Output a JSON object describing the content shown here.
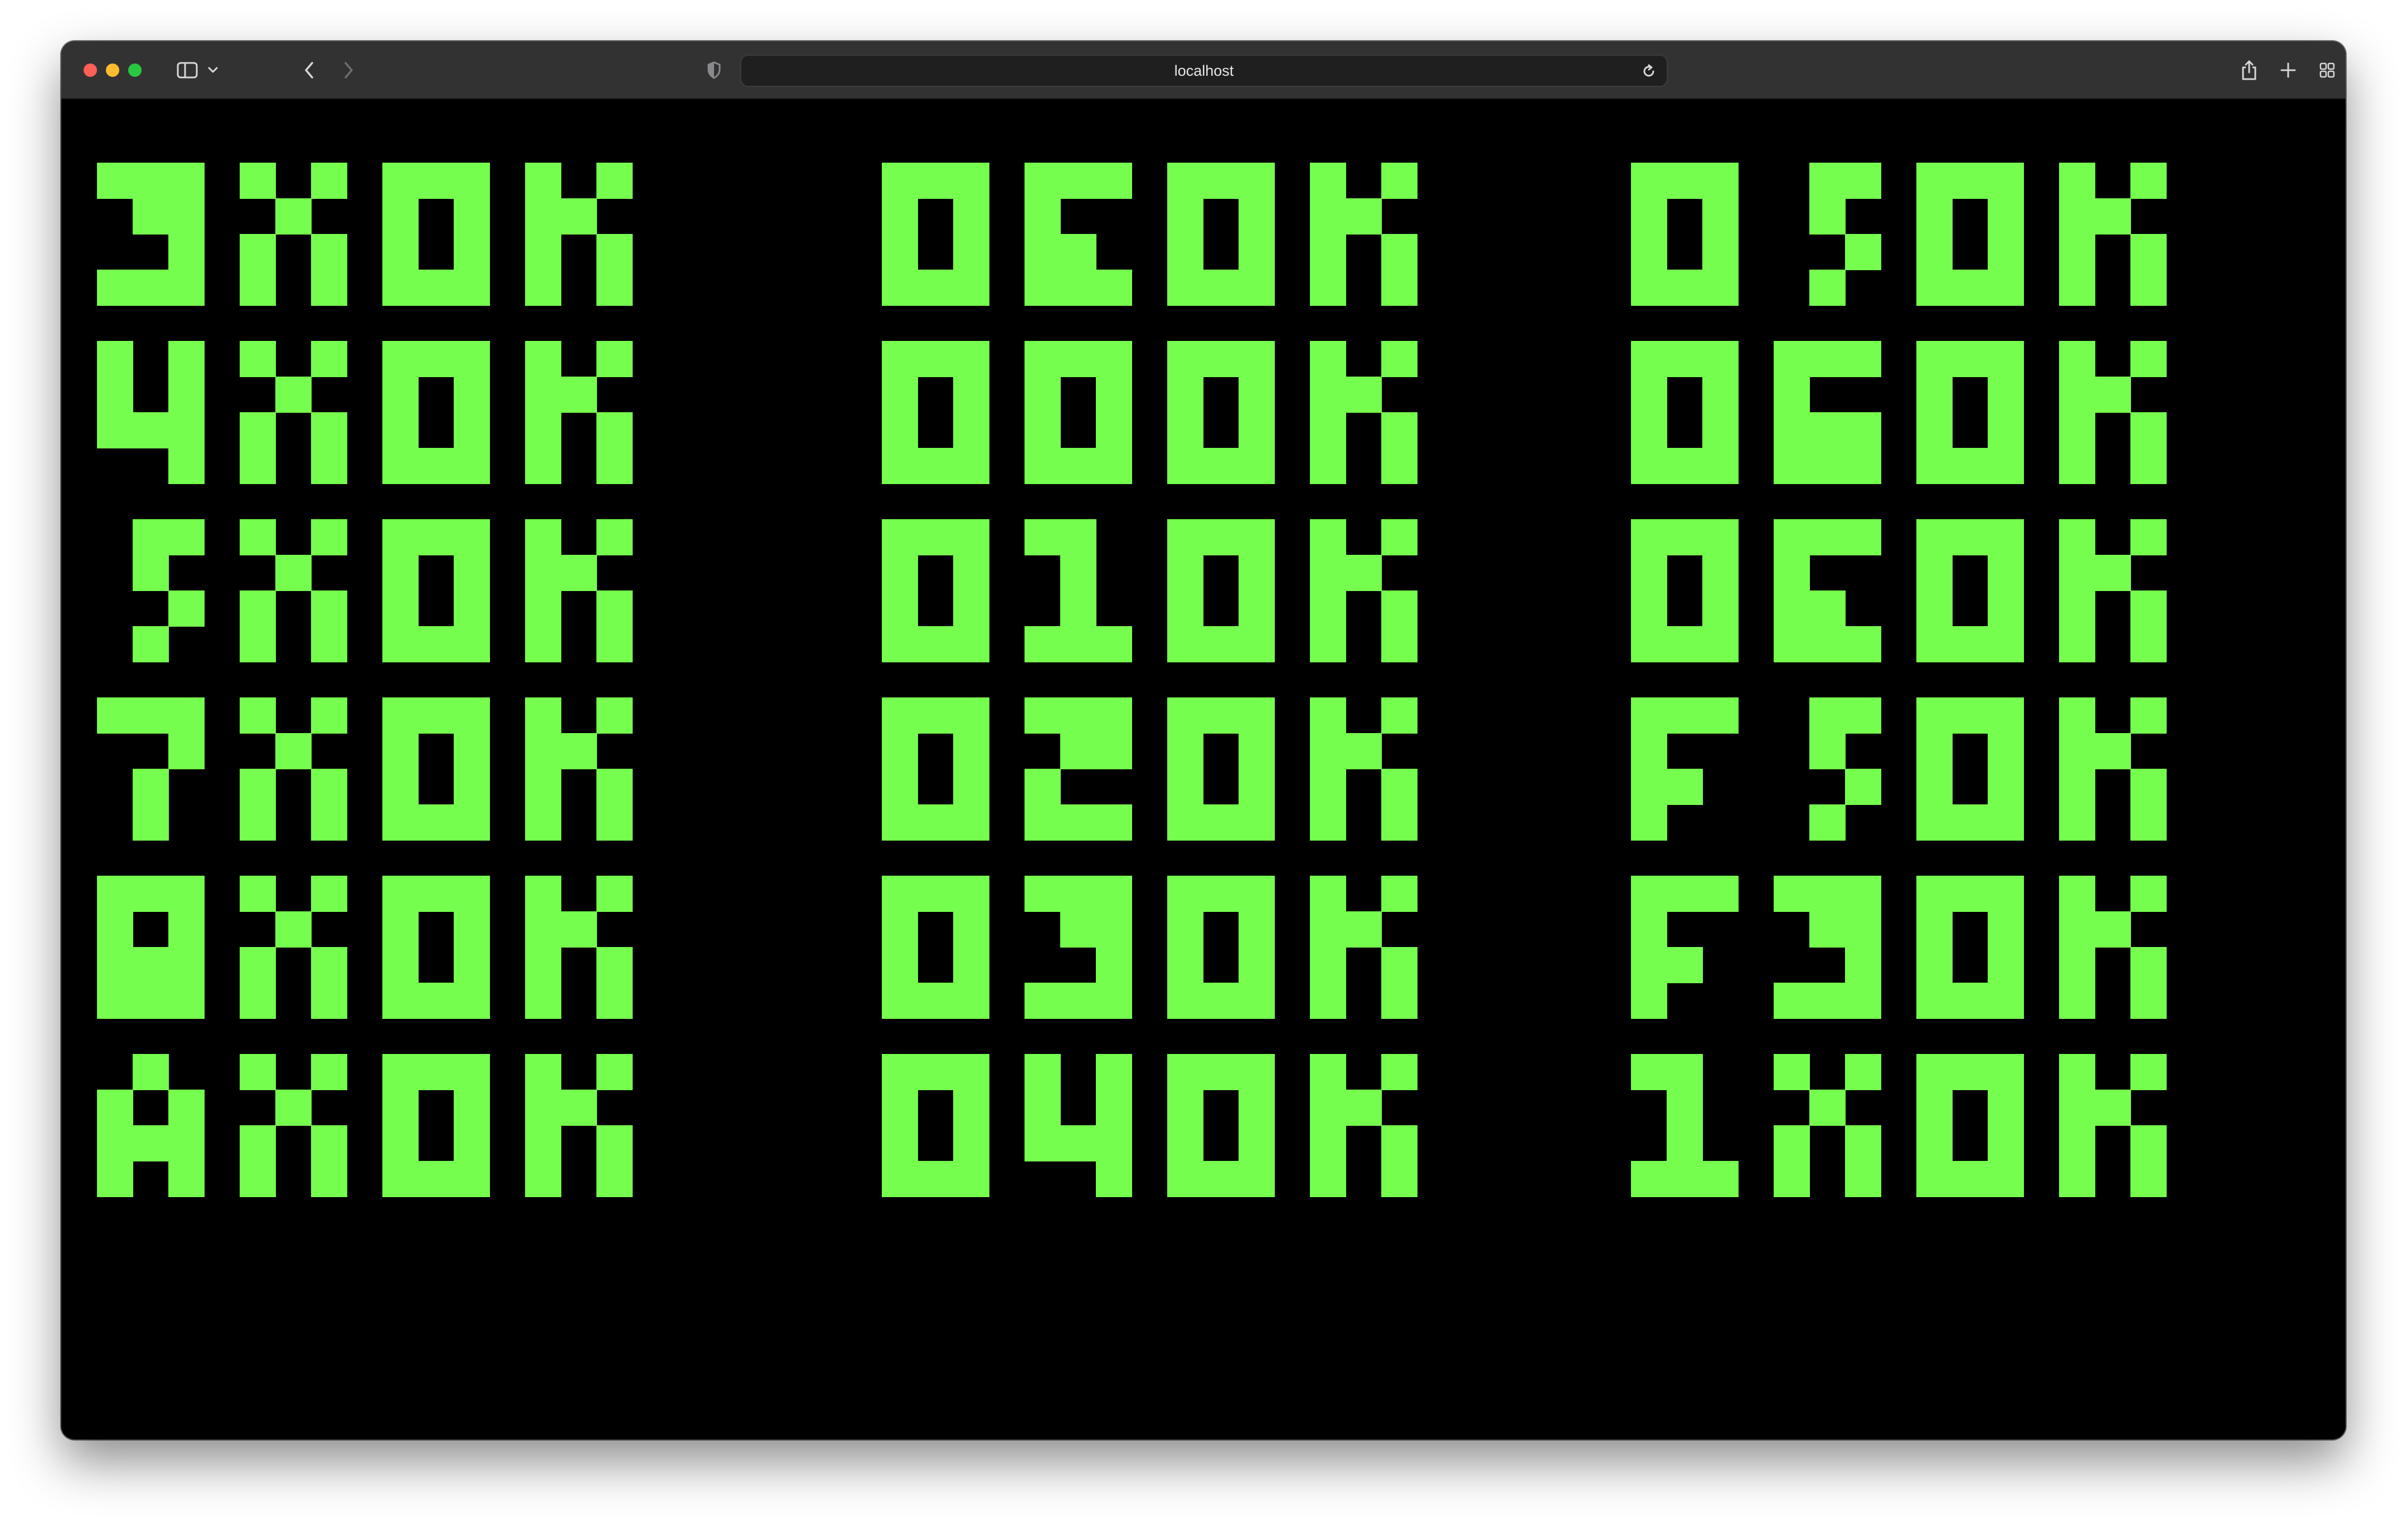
{
  "browser": {
    "address": "localhost",
    "traffic_lights": {
      "close": "#fe5f57",
      "minimize": "#febc2e",
      "maximize": "#28c840"
    },
    "icons": {
      "sidebar": "sidebar-icon",
      "sidebar_menu": "chevron-down-icon",
      "back": "chevron-left-icon",
      "forward": "chevron-right-icon",
      "privacy": "shield-icon",
      "reload": "reload-icon",
      "share": "share-icon",
      "new_tab": "plus-icon",
      "tab_overview": "tab-overview-icon"
    }
  },
  "display": {
    "foreground": "#76fe4e",
    "background": "#000000",
    "columns": [
      {
        "rows": [
          [
            "3",
            "X",
            "O",
            "K"
          ],
          [
            "4",
            "X",
            "O",
            "K"
          ],
          [
            "5",
            "X",
            "O",
            "K"
          ],
          [
            "7",
            "X",
            "O",
            "K"
          ],
          [
            "9",
            "X",
            "O",
            "K"
          ],
          [
            "A",
            "X",
            "O",
            "K"
          ]
        ]
      },
      {
        "rows": [
          [
            "0",
            "E",
            "O",
            "K"
          ],
          [
            "0",
            "0",
            "O",
            "K"
          ],
          [
            "0",
            "1",
            "O",
            "K"
          ],
          [
            "0",
            "2",
            "O",
            "K"
          ],
          [
            "0",
            "3",
            "O",
            "K"
          ],
          [
            "0",
            "4",
            "O",
            "K"
          ]
        ]
      },
      {
        "rows": [
          [
            "0",
            "5",
            "O",
            "K"
          ],
          [
            "0",
            "6",
            "O",
            "K"
          ],
          [
            "0",
            "E",
            "O",
            "K"
          ],
          [
            "F",
            "5",
            "O",
            "K"
          ],
          [
            "F",
            "3",
            "O",
            "K"
          ],
          [
            "1",
            "X",
            "O",
            "K"
          ]
        ]
      }
    ]
  }
}
